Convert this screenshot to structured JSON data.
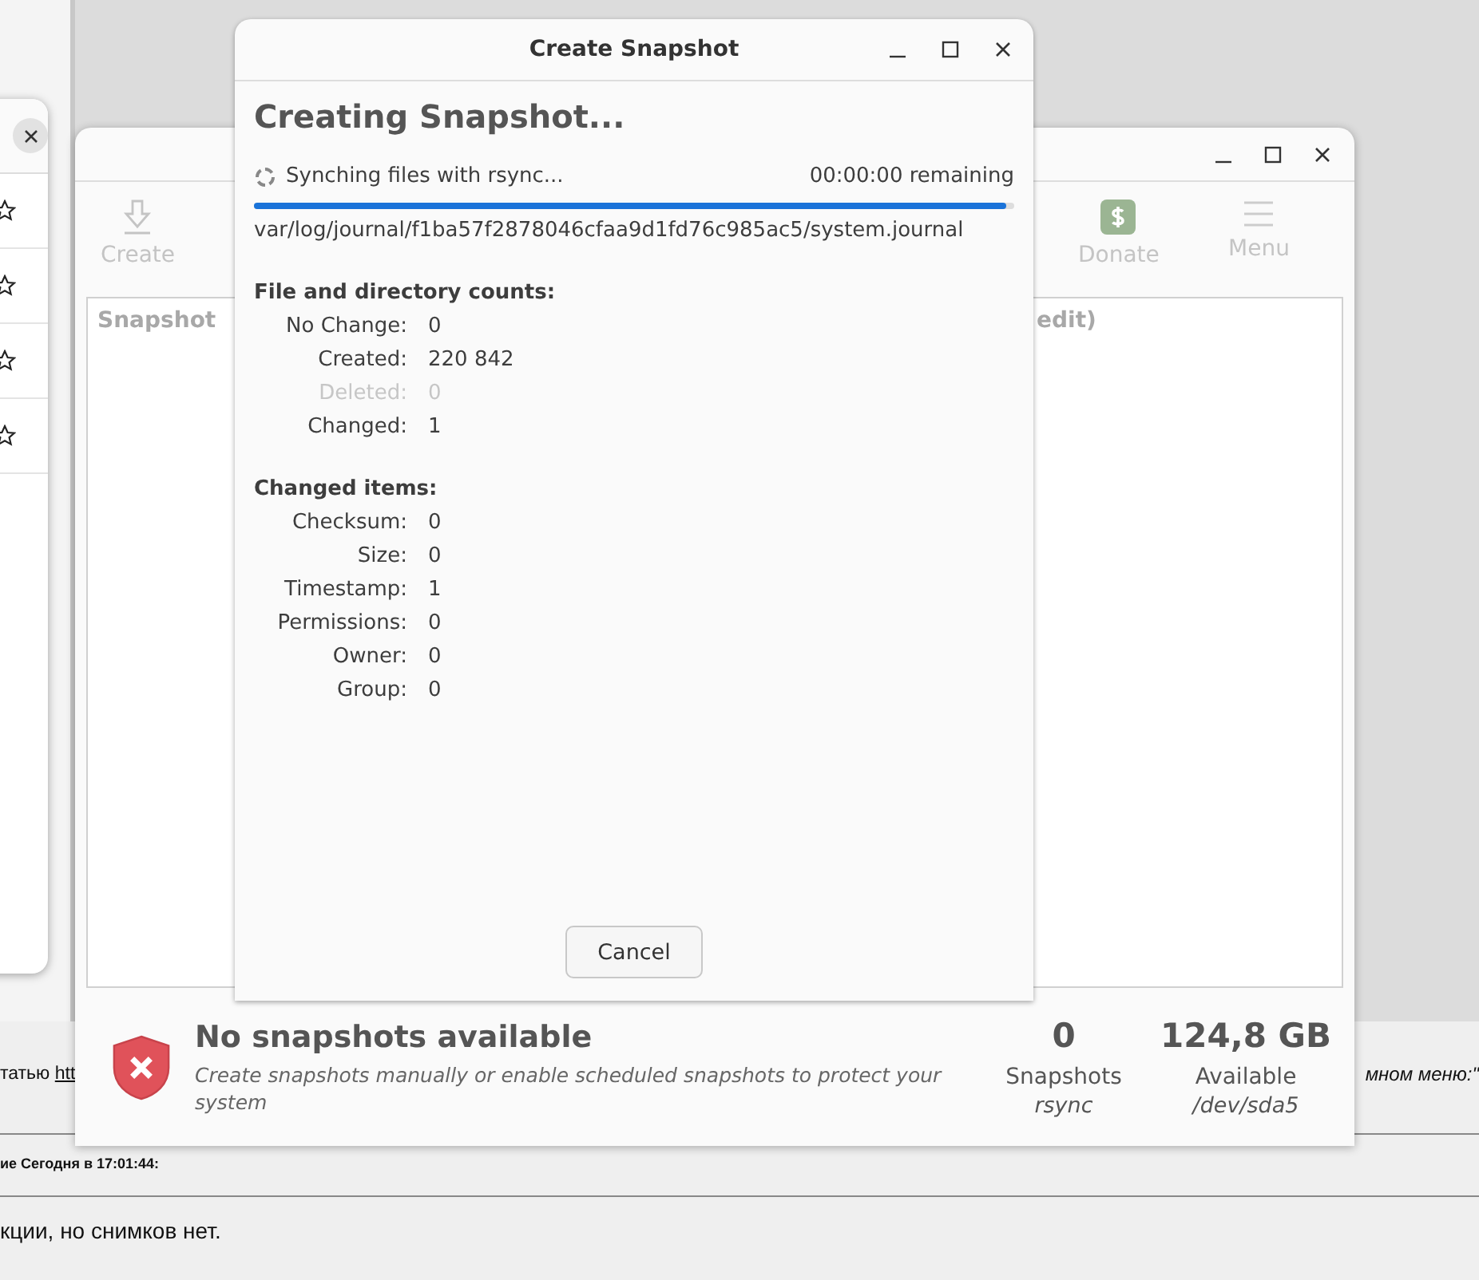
{
  "background_page": {
    "intro_text": "татью",
    "intro_link": "htt",
    "right_text": "мном меню:\"",
    "post_header": "ие Сегодня в 17:01:44:",
    "post_text": "кции, но снимков нет."
  },
  "left_window": {
    "rows": [
      {
        "kind": "star"
      },
      {
        "kind": "star"
      },
      {
        "kind": "star"
      },
      {
        "kind": "star"
      }
    ]
  },
  "main_window": {
    "toolbar": [
      {
        "kind": "create",
        "label": "Create"
      },
      {
        "kind": "donate",
        "label": "Donate"
      },
      {
        "kind": "menu",
        "label": "Menu"
      }
    ],
    "table": {
      "columns": [
        "Snapshot",
        "edit)"
      ]
    },
    "status": {
      "title": "No snapshots available",
      "description": "Create snapshots manually or enable scheduled snapshots to protect your system",
      "stats": [
        {
          "value": "0",
          "label": "Snapshots",
          "detail": "rsync"
        },
        {
          "value": "124,8 GB",
          "label": "Available",
          "detail": "/dev/sda5"
        }
      ]
    }
  },
  "dialog": {
    "title": "Create Snapshot",
    "heading": "Creating Snapshot...",
    "status": "Synching files with rsync...",
    "remaining": "00:00:00 remaining",
    "level": 0.99,
    "file": "var/log/journal/f1ba57f2878046cfaa9d1fd76c985ac5/system.journal",
    "sections": [
      {
        "title": "File and directory counts:",
        "rows": [
          {
            "label": "No Change:",
            "value": "0",
            "disabled": false
          },
          {
            "label": "Created:",
            "value": "220 842",
            "disabled": false
          },
          {
            "label": "Deleted:",
            "value": "0",
            "disabled": true
          },
          {
            "label": "Changed:",
            "value": "1",
            "disabled": false
          }
        ]
      },
      {
        "title": "Changed items:",
        "rows": [
          {
            "label": "Checksum:",
            "value": "0",
            "disabled": false
          },
          {
            "label": "Size:",
            "value": "0",
            "disabled": false
          },
          {
            "label": "Timestamp:",
            "value": "1",
            "disabled": false
          },
          {
            "label": "Permissions:",
            "value": "0",
            "disabled": false
          },
          {
            "label": "Owner:",
            "value": "0",
            "disabled": false
          },
          {
            "label": "Group:",
            "value": "0",
            "disabled": false
          }
        ]
      }
    ],
    "buttons": [
      "Cancel"
    ]
  }
}
